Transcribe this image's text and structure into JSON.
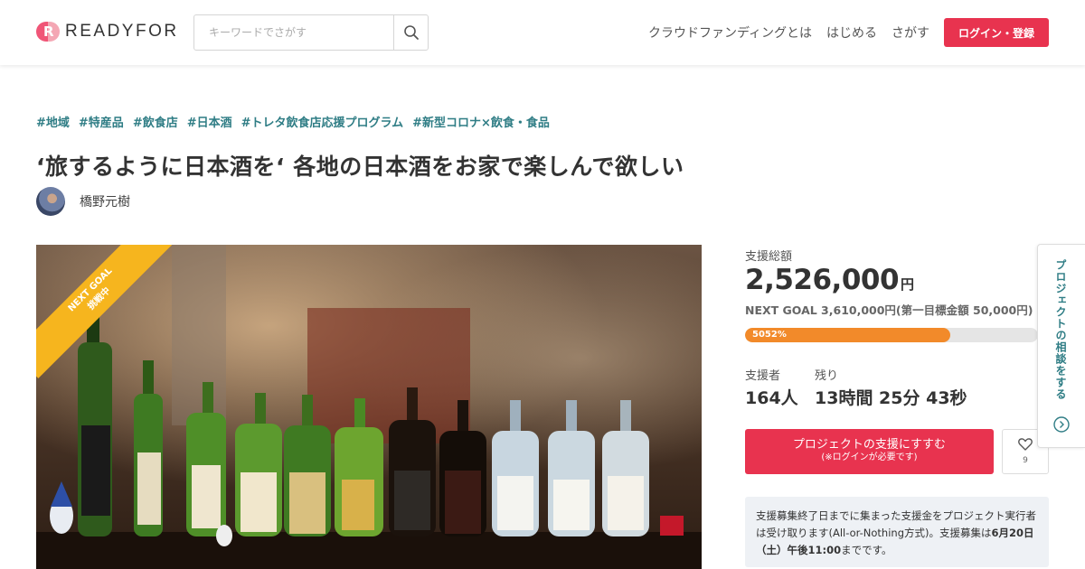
{
  "header": {
    "logo_text": "READYFOR",
    "search_placeholder": "キーワードでさがす",
    "nav": [
      "クラウドファンディングとは",
      "はじめる",
      "さがす"
    ],
    "login_label": "ログイン・登録"
  },
  "project": {
    "tags": [
      "#地域",
      "#特産品",
      "#飲食店",
      "#日本酒",
      "#トレタ飲食店応援プログラム",
      "#新型コロナ×飲食・食品"
    ],
    "title": "‘旅するように日本酒を‘ 各地の日本酒をお家で楽しんで欲しい",
    "owner_name": "橋野元樹",
    "ribbon_line1": "NEXT GOAL",
    "ribbon_line2": "挑戦中"
  },
  "stats": {
    "total_label": "支援総額",
    "total_amount": "2,526,000",
    "total_unit": "円",
    "next_goal": "NEXT GOAL 3,610,000円(第一目標金額 50,000円)",
    "progress_label": "5052%",
    "progress_fraction": 0.7,
    "supporters_label": "支援者",
    "supporters_value": "164人",
    "remaining_label": "残り",
    "remaining_value": "13時間 25分 43秒"
  },
  "actions": {
    "support_label": "プロジェクトの支援にすすむ",
    "support_sub": "(※ログインが必要です)",
    "favorite_count": "9"
  },
  "notice": {
    "text_before": "支援募集終了日までに集まった支援金をプロジェクト実行者は受け取ります(All-or-Nothing方式)。支援募集は",
    "deadline": "6月20日（土）午後11:00",
    "text_after": "までです。"
  },
  "consult_tab": {
    "label": "プロジェクトの相談をする"
  },
  "colors": {
    "accent": "#e8334f",
    "tag": "#2f7d85",
    "progress": "#f28a2a",
    "ribbon": "#f6b51e"
  }
}
